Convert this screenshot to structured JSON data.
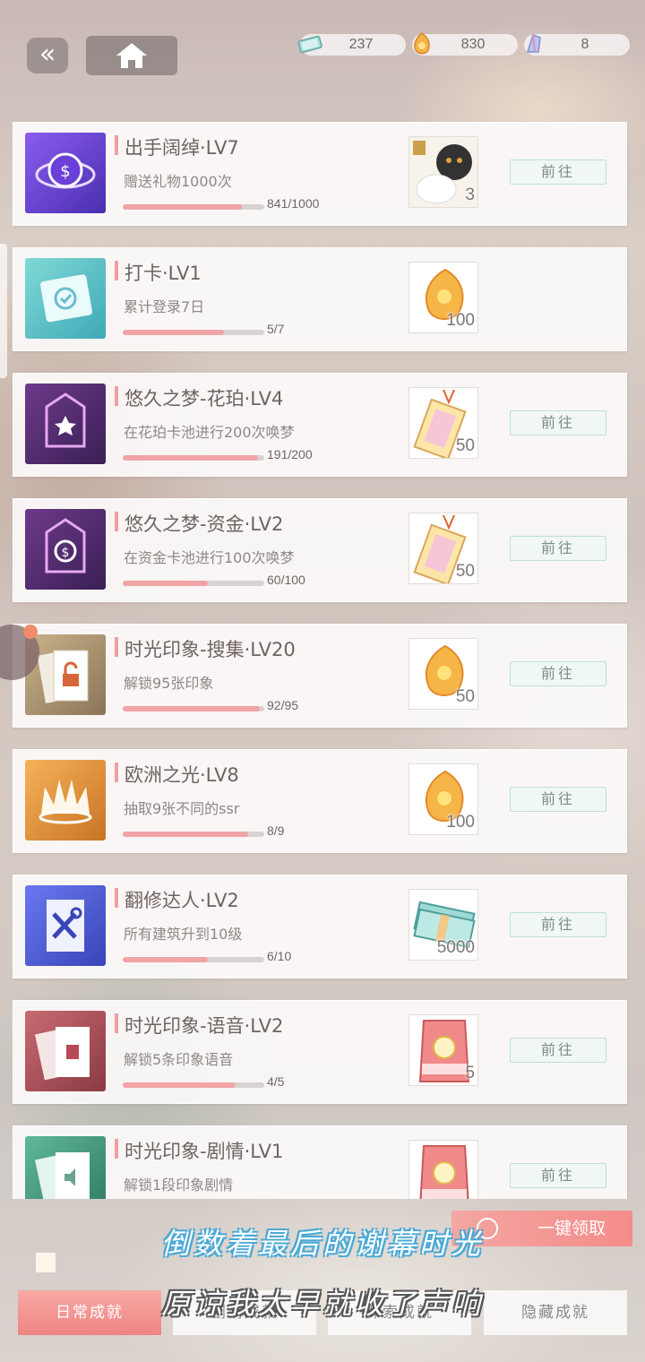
{
  "topbar": {
    "back_glyph": "«",
    "currencies": [
      {
        "name": "banknote-icon",
        "value": "237"
      },
      {
        "name": "amber-coin-icon",
        "value": "830"
      },
      {
        "name": "crystal-icon",
        "value": "8"
      }
    ]
  },
  "achievements": [
    {
      "icon": "coin-ring-icon",
      "title": "出手阔绰·LV7",
      "desc": "赠送礼物1000次",
      "progress": "841/1000",
      "fill": 0.841,
      "reward": "cat-card-item",
      "reward_count": "3",
      "goto": "前往"
    },
    {
      "icon": "checkin-icon",
      "title": "打卡·LV1",
      "desc": "累计登录7日",
      "progress": "5/7",
      "fill": 0.714,
      "reward": "amber-item",
      "reward_count": "100",
      "goto": ""
    },
    {
      "icon": "flower-gate-icon",
      "title": "悠久之梦-花珀·LV4",
      "desc": "在花珀卡池进行200次唤梦",
      "progress": "191/200",
      "fill": 0.955,
      "reward": "charm-ticket-item",
      "reward_count": "50",
      "goto": "前往"
    },
    {
      "icon": "coin-gate-icon",
      "title": "悠久之梦-资金·LV2",
      "desc": "在资金卡池进行100次唤梦",
      "progress": "60/100",
      "fill": 0.6,
      "reward": "charm-ticket-item",
      "reward_count": "50",
      "goto": "前往"
    },
    {
      "icon": "unlock-cards-icon",
      "title": "时光印象-搜集·LV20",
      "desc": "解锁95张印象",
      "progress": "92/95",
      "fill": 0.968,
      "reward": "amber-item",
      "reward_count": "50",
      "goto": "前往"
    },
    {
      "icon": "crown-icon",
      "title": "欧洲之光·LV8",
      "desc": "抽取9张不同的ssr",
      "progress": "8/9",
      "fill": 0.889,
      "reward": "amber-item",
      "reward_count": "100",
      "goto": "前往"
    },
    {
      "icon": "tools-icon",
      "title": "翻修达人·LV2",
      "desc": "所有建筑升到10级",
      "progress": "6/10",
      "fill": 0.6,
      "reward": "banknote-stack-item",
      "reward_count": "5000",
      "goto": "前往"
    },
    {
      "icon": "book-cards-icon",
      "title": "时光印象-语音·LV2",
      "desc": "解锁5条印象语音",
      "progress": "4/5",
      "fill": 0.8,
      "reward": "catfood-item",
      "reward_count": "5",
      "goto": "前往"
    },
    {
      "icon": "sound-cards-icon",
      "title": "时光印象-剧情·LV1",
      "desc": "解锁1段印象剧情",
      "progress": "",
      "fill": 0.0,
      "reward": "catfood-item",
      "reward_count": "",
      "goto": "前往"
    }
  ],
  "claim_all": "一键领取",
  "subtitles": [
    "倒数着最后的谢幕时光",
    "原谅我太早就收了声响"
  ],
  "tabs": [
    "日常成就",
    "剧情成就",
    "探索成就",
    "隐藏成就"
  ]
}
